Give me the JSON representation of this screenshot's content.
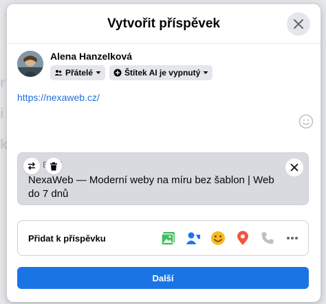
{
  "modal": {
    "title": "Vytvořit příspěvek"
  },
  "author": {
    "name": "Alena Hanzelková",
    "audience_label": "Přátelé",
    "ai_label": "Štítek AI je vypnutý"
  },
  "post": {
    "text": "https://nexaweb.cz/"
  },
  "link_preview": {
    "domain": "NEXAWEB.CZ",
    "domain_visible": "B.CZ",
    "title": "NexaWeb — Moderní weby na míru bez šablon | Web do 7 dnů"
  },
  "add_to_post": {
    "label": "Přidat k příspěvku",
    "icons": [
      "photo-video-icon",
      "tag-people-icon",
      "feeling-icon",
      "location-icon",
      "call-icon",
      "more-icon"
    ]
  },
  "footer": {
    "next_label": "Další"
  },
  "colors": {
    "accent": "#1b74e4",
    "link": "#216fdb",
    "photo_green": "#45bd62",
    "tag_blue": "#1877f2",
    "feeling_yellow": "#f7b928",
    "location_red": "#f5533d"
  }
}
